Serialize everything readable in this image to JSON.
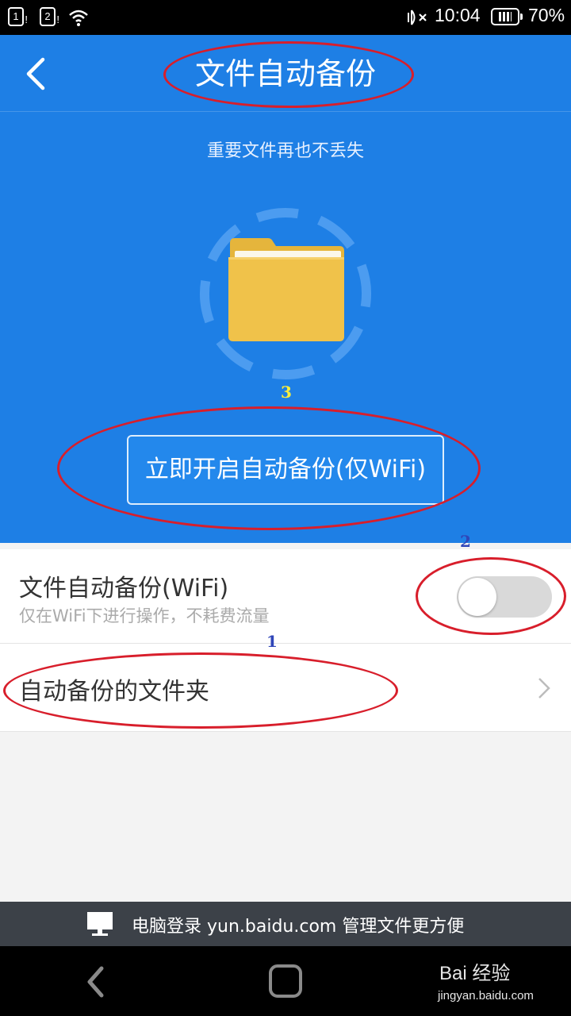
{
  "status_bar": {
    "sim1": "1",
    "sim2": "2",
    "time": "10:04",
    "battery": "70%",
    "icons": [
      "sim-card-icon",
      "sim-card-icon",
      "wifi-icon",
      "vibrate-icon",
      "battery-icon"
    ]
  },
  "header": {
    "title": "文件自动备份",
    "subtitle": "重要文件再也不丢失",
    "back_icon": "chevron-left-icon",
    "folder_icon": "folder-icon"
  },
  "primary_button": {
    "label": "立即开启自动备份(仅WiFi)"
  },
  "settings": {
    "wifi_backup": {
      "title": "文件自动备份(WiFi)",
      "description": "仅在WiFi下进行操作，不耗费流量",
      "enabled": false
    },
    "backup_folder": {
      "title": "自动备份的文件夹",
      "icon": "chevron-right-icon"
    }
  },
  "annotations": {
    "num1": "1",
    "num2": "2",
    "num3": "3"
  },
  "footer": {
    "text": "电脑登录 yun.baidu.com 管理文件更方便",
    "icon": "monitor-icon"
  },
  "navigation": {
    "back_icon": "nav-back-icon",
    "home_icon": "nav-home-icon"
  },
  "watermark": {
    "brand": "Bai 经验",
    "url": "jingyan.baidu.com"
  },
  "colors": {
    "header_blue": "#1e7fe5",
    "annotation_red": "#d81e2b",
    "folder_yellow": "#f0c24a"
  }
}
